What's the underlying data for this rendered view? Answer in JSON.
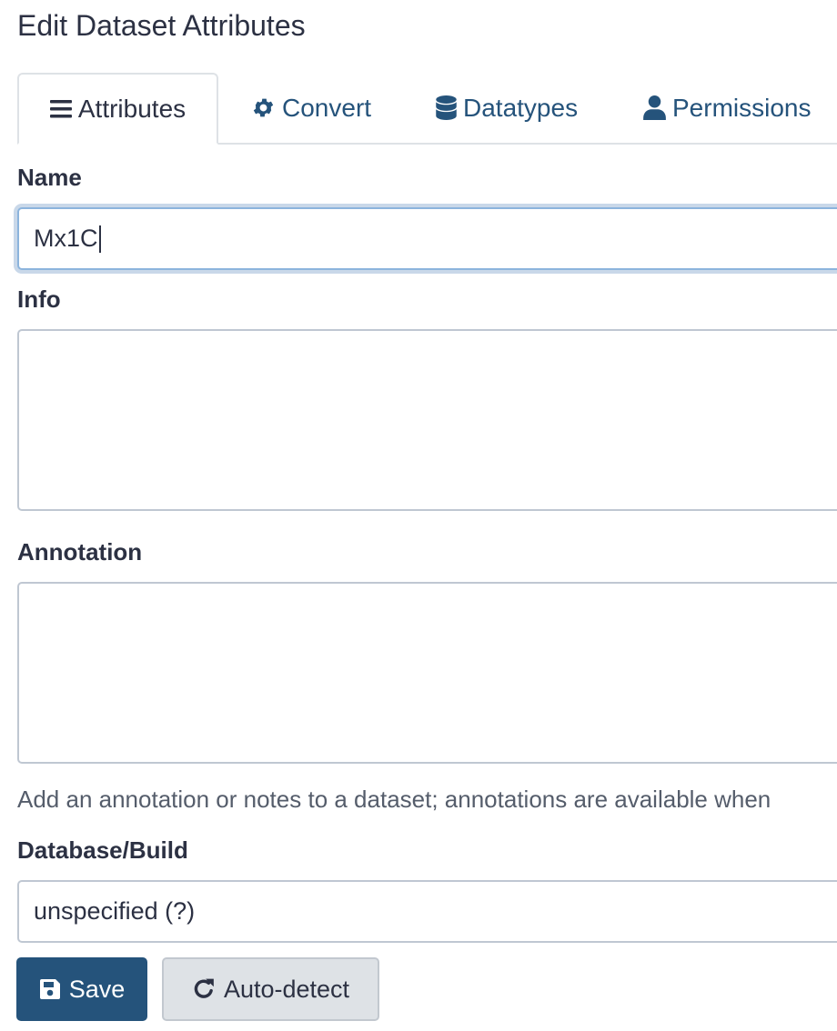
{
  "page": {
    "title": "Edit Dataset Attributes"
  },
  "tabs": [
    {
      "label": "Attributes",
      "icon": "bars-icon",
      "active": true
    },
    {
      "label": "Convert",
      "icon": "gear-icon",
      "active": false
    },
    {
      "label": "Datatypes",
      "icon": "database-icon",
      "active": false
    },
    {
      "label": "Permissions",
      "icon": "user-icon",
      "active": false
    }
  ],
  "form": {
    "name": {
      "label": "Name",
      "value": "Mx1C"
    },
    "info": {
      "label": "Info",
      "value": ""
    },
    "annotation": {
      "label": "Annotation",
      "value": "",
      "help": "Add an annotation or notes to a dataset; annotations are available when"
    },
    "dbkey": {
      "label": "Database/Build",
      "value": "unspecified (?)"
    }
  },
  "buttons": {
    "save": "Save",
    "auto_detect": "Auto-detect"
  },
  "colors": {
    "primary": "#25537b",
    "text": "#2c3143",
    "border": "#bfc7d2",
    "focus": "#8cb4dd"
  }
}
